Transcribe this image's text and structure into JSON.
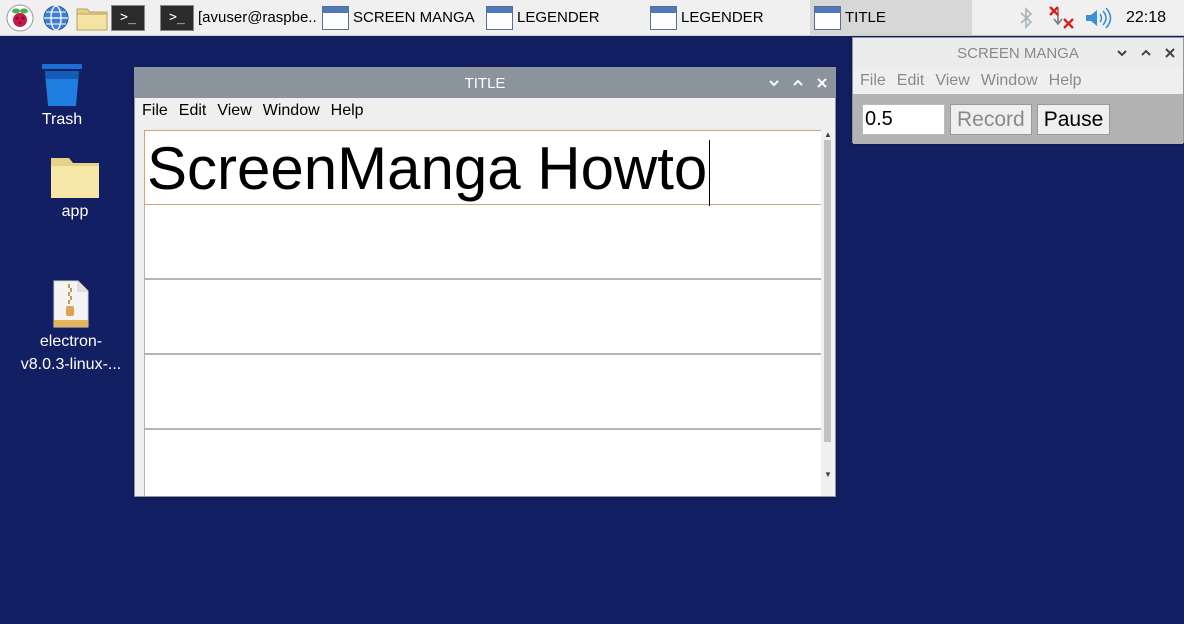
{
  "taskbar": {
    "launchers": [
      {
        "name": "raspberry-menu-icon"
      },
      {
        "name": "browser-icon"
      },
      {
        "name": "file-manager-icon"
      },
      {
        "name": "terminal-icon"
      }
    ],
    "tasks": [
      {
        "label": "[avuser@raspbe..."
      },
      {
        "label": "SCREEN MANGA"
      },
      {
        "label": "LEGENDER"
      },
      {
        "label": "LEGENDER"
      },
      {
        "label": "TITLE"
      }
    ],
    "clock": "22:18"
  },
  "desktop": {
    "icons": [
      {
        "label": "Trash"
      },
      {
        "label": "app"
      },
      {
        "label_line1": "electron-",
        "label_line2": "v8.0.3-linux-..."
      }
    ]
  },
  "main_window": {
    "title": "TITLE",
    "menu": [
      "File",
      "Edit",
      "View",
      "Window",
      "Help"
    ],
    "lines": [
      "ScreenManga Howto",
      "",
      "",
      "",
      ""
    ]
  },
  "control_window": {
    "title": "SCREEN MANGA",
    "menu": [
      "File",
      "Edit",
      "View",
      "Window",
      "Help"
    ],
    "input_value": "0.5",
    "record_label": "Record",
    "pause_label": "Pause"
  },
  "colors": {
    "desktop_bg": "#121f63",
    "active_titlebar": "#8b939c",
    "focus_border": "#d2a86a"
  }
}
